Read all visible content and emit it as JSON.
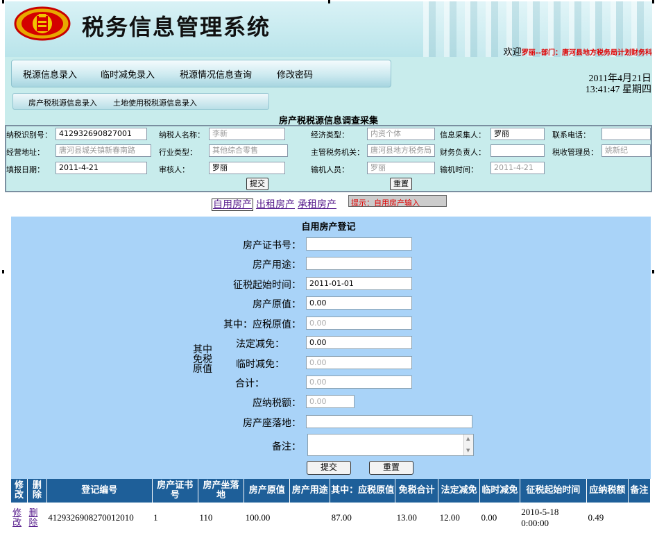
{
  "header": {
    "system_title": "税务信息管理系统",
    "welcome_prefix": "欢迎",
    "welcome_user": "罗丽--部门：唐河县地方税务局计划财务科"
  },
  "menu": {
    "items": [
      "税源信息录入",
      "临时减免录入",
      "税源情况信息查询",
      "修改密码"
    ],
    "sub_items": [
      "房产税税源信息录入",
      "土地使用税税源信息录入"
    ]
  },
  "datetime": {
    "date": "2011年4月21日",
    "time": "13:41:47 星期四"
  },
  "form": {
    "title": "房产税税源信息调查采集",
    "taxpayer_id_label": "纳税识别号：",
    "taxpayer_id_value": "412932690827001",
    "taxpayer_name_label": "纳税人名称：",
    "taxpayer_name_value": "李新",
    "economic_type_label": "经济类型：",
    "economic_type_value": "内资个体",
    "collector_label": "信息采集人：",
    "collector_value": "罗丽",
    "phone_label": "联系电话：",
    "phone_value": "",
    "address_label": "经营地址：",
    "address_value": "唐河县城关镇新春南路",
    "industry_label": "行业类型：",
    "industry_value": "其他综合零售",
    "tax_office_label": "主管税务机关：",
    "tax_office_value": "唐河县地方税务局",
    "finance_label": "财务负责人：",
    "finance_value": "",
    "tax_manager_label": "税收管理员：",
    "tax_manager_value": "姚新纪",
    "fill_date_label": "填报日期：",
    "fill_date_value": "2011-4-21",
    "auditor_label": "审核人：",
    "auditor_value": "罗丽",
    "entry_person_label": "输机人员：",
    "entry_person_value": "罗丽",
    "entry_time_label": "输机时间：",
    "entry_time_value": "2011-4-21",
    "submit_label": "提交",
    "reset_label": "重置"
  },
  "tabs": {
    "items": [
      "自用房产",
      "出租房产",
      "承租房产"
    ],
    "hint": "提示：自用房产输入"
  },
  "self_use": {
    "title": "自用房产登记",
    "cert_label": "房产证书号：",
    "cert_value": "",
    "usage_label": "房产用途：",
    "usage_value": "",
    "start_label": "征税起始时间：",
    "start_value": "2011-01-01",
    "orig_label": "房产原值：",
    "orig_value": "0.00",
    "taxable_label": "其中：应税原值：",
    "taxable_value": "0.00",
    "group_label": "其中免税原值",
    "legal_label": "法定减免：",
    "legal_value": "0.00",
    "temp_label": "临时减免：",
    "temp_value": "0.00",
    "total_label": "合计：",
    "total_value": "0.00",
    "tax_label": "应纳税额：",
    "tax_value": "0.00",
    "location_label": "房产座落地：",
    "location_value": "",
    "remark_label": "备注：",
    "submit_label": "提交",
    "reset_label": "重置"
  },
  "table": {
    "headers": [
      "修改",
      "删除",
      "登记编号",
      "房产证书号",
      "房产坐落地",
      "房产原值",
      "房产用途",
      "其中：应税原值",
      "免税合计",
      "法定减免",
      "临时减免",
      "征税起始时间",
      "应纳税额",
      "备注"
    ],
    "rows": [
      {
        "edit": "修改",
        "delete": "删除",
        "reg_no": "4129326908270012010",
        "cert_no": "1",
        "location": "110",
        "orig": "100.00",
        "usage": "",
        "taxable": "87.00",
        "exempt_total": "13.00",
        "legal": "12.00",
        "temp": "0.00",
        "start": "2010-5-18 0:00:00",
        "tax": "0.49",
        "remark": ""
      }
    ]
  }
}
